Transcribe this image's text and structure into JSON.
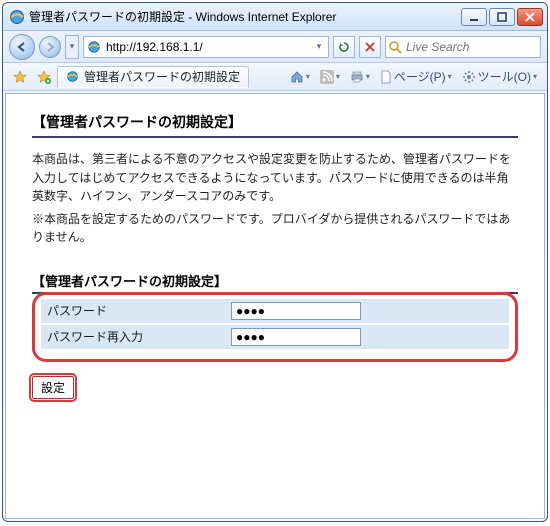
{
  "window": {
    "title": "管理者パスワードの初期設定 - Windows Internet Explorer"
  },
  "nav": {
    "url": "http://192.168.1.1/"
  },
  "search": {
    "placeholder": "Live Search"
  },
  "tab": {
    "title": "管理者パスワードの初期設定"
  },
  "toolbar": {
    "page_label": "ページ(P)",
    "tool_label": "ツール(O)"
  },
  "content": {
    "heading": "【管理者パスワードの初期設定】",
    "p1": "本商品は、第三者による不意のアクセスや設定変更を防止するため、管理者パスワードを入力してはじめてアクセスできるようになっています。パスワードに使用できるのは半角英数字、ハイフン、アンダースコアのみです。",
    "p2": "※本商品を設定するためのパスワードです。プロバイダから提供されるパスワードではありません。",
    "section_label": "【管理者パスワードの初期設定】",
    "pw_label": "パスワード",
    "pw_confirm_label": "パスワード再入力",
    "pw_value": "●●●●",
    "pw_confirm_value": "●●●●",
    "submit_label": "設定"
  }
}
